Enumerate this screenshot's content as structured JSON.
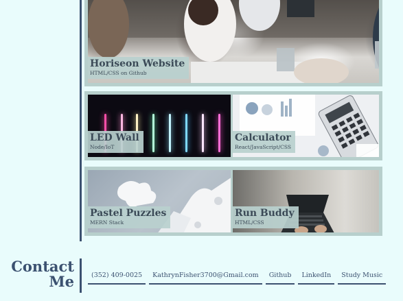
{
  "projects": [
    {
      "title": "Horiseon Website",
      "subtitle": "HTML/CSS on Github"
    },
    {
      "title": "LED Wall",
      "subtitle": "Node/IoT"
    },
    {
      "title": "Calculator",
      "subtitle": "React/JavaScript/CSS"
    },
    {
      "title": "Pastel Puzzles",
      "subtitle": "MERN Stack"
    },
    {
      "title": "Run Buddy",
      "subtitle": "HTML/CSS"
    }
  ],
  "contact": {
    "heading_line1": "Contact",
    "heading_line2": "Me",
    "links": [
      {
        "label": "(352) 409-0025"
      },
      {
        "label": "KathrynFisher3700@Gmail.com"
      },
      {
        "label": "Github"
      },
      {
        "label": "LinkedIn"
      },
      {
        "label": "Study Music"
      }
    ]
  },
  "colors": {
    "background": "#e9fcfc",
    "accent": "#3b5170",
    "card_border": "#b7cfcc"
  }
}
